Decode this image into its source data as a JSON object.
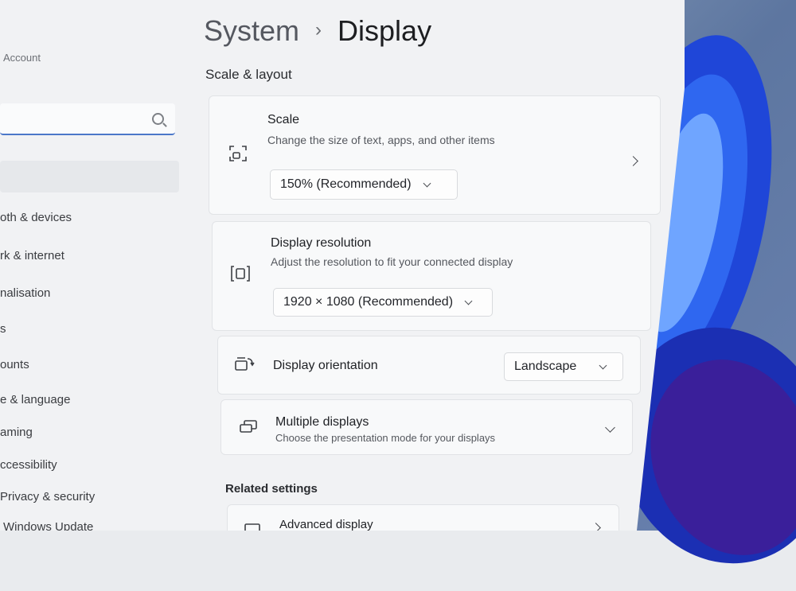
{
  "sidebar": {
    "account_label": "Account",
    "items": [
      {
        "label": "oth & devices"
      },
      {
        "label": "rk & internet"
      },
      {
        "label": "nalisation"
      },
      {
        "label": "s"
      },
      {
        "label": "ounts"
      },
      {
        "label": "e & language"
      },
      {
        "label": "aming"
      },
      {
        "label": "ccessibility"
      },
      {
        "label": "Privacy & security"
      },
      {
        "label": "Windows Update"
      }
    ]
  },
  "header": {
    "parent": "System",
    "separator": "›",
    "title": "Display"
  },
  "section": {
    "title": "Scale & layout"
  },
  "scale": {
    "title": "Scale",
    "description": "Change the size of text, apps, and other items",
    "value": "150% (Recommended)",
    "icon": "scale-icon"
  },
  "resolution": {
    "title": "Display resolution",
    "description": "Adjust the resolution to fit your connected display",
    "value": "1920 × 1080 (Recommended)",
    "icon": "resolution-icon"
  },
  "orientation": {
    "title": "Display orientation",
    "value": "Landscape",
    "icon": "orientation-icon"
  },
  "multiple": {
    "title": "Multiple displays",
    "description": "Choose the presentation mode for your displays",
    "icon": "multiple-displays-icon"
  },
  "related": {
    "title": "Related settings",
    "advanced": "Advanced display"
  },
  "colors": {
    "accent": "#4b77c9",
    "wallpaper_blue": "#1f46d8"
  }
}
